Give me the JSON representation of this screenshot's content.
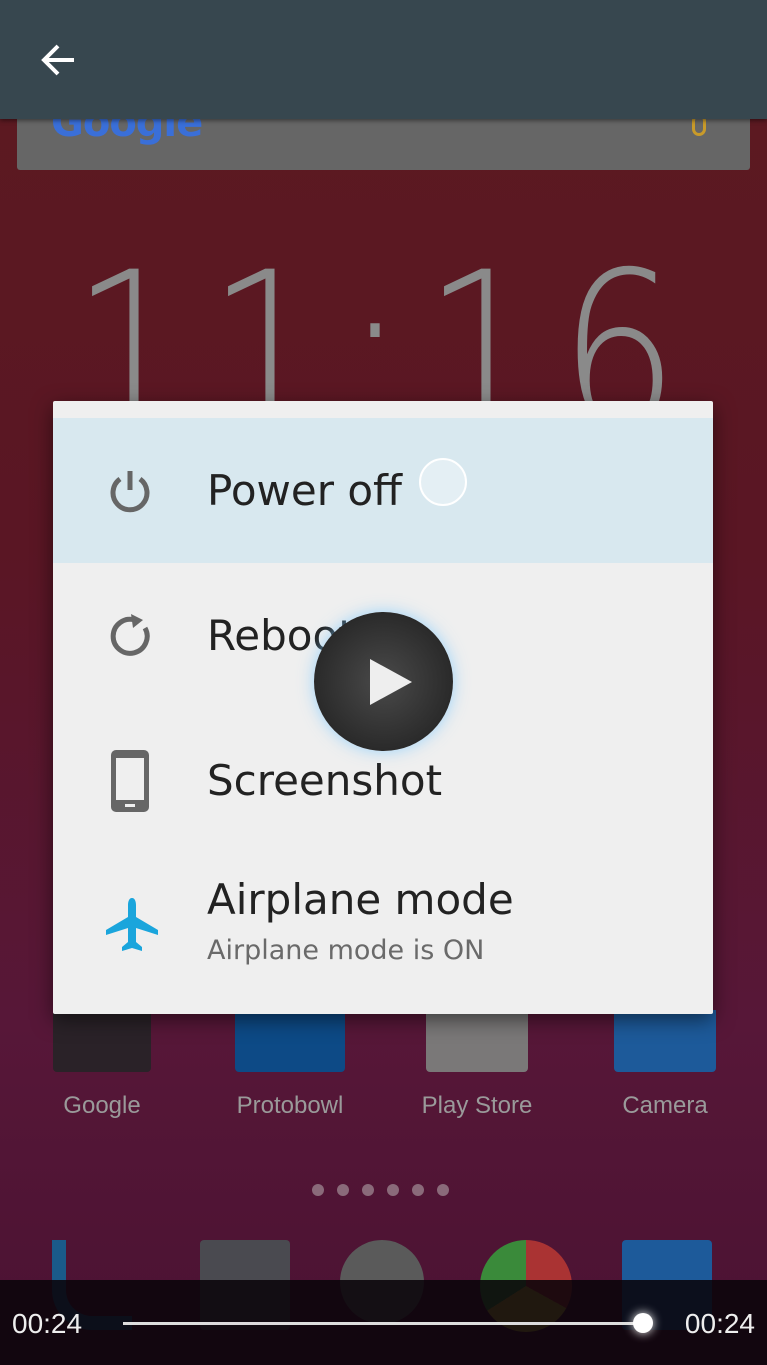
{
  "header": {
    "back_icon": "arrow-left-icon"
  },
  "home": {
    "search_logo": "Google",
    "clock": "11:16",
    "apps": [
      {
        "label": "Google"
      },
      {
        "label": "Protobowl"
      },
      {
        "label": "Play Store"
      },
      {
        "label": "Camera"
      }
    ],
    "page_count": 6
  },
  "dialog": {
    "items": [
      {
        "label": "Power off",
        "icon": "power-icon"
      },
      {
        "label": "Reboot",
        "icon": "refresh-icon"
      },
      {
        "label": "Screenshot",
        "icon": "phone-icon"
      },
      {
        "label": "Airplane mode",
        "sub": "Airplane mode is ON",
        "icon": "airplane-icon"
      }
    ]
  },
  "player": {
    "elapsed": "00:24",
    "duration": "00:24",
    "progress": 1.0
  },
  "colors": {
    "accent": "#1aa5dc",
    "header": "#37474f",
    "selected": "#d8e8ef"
  }
}
